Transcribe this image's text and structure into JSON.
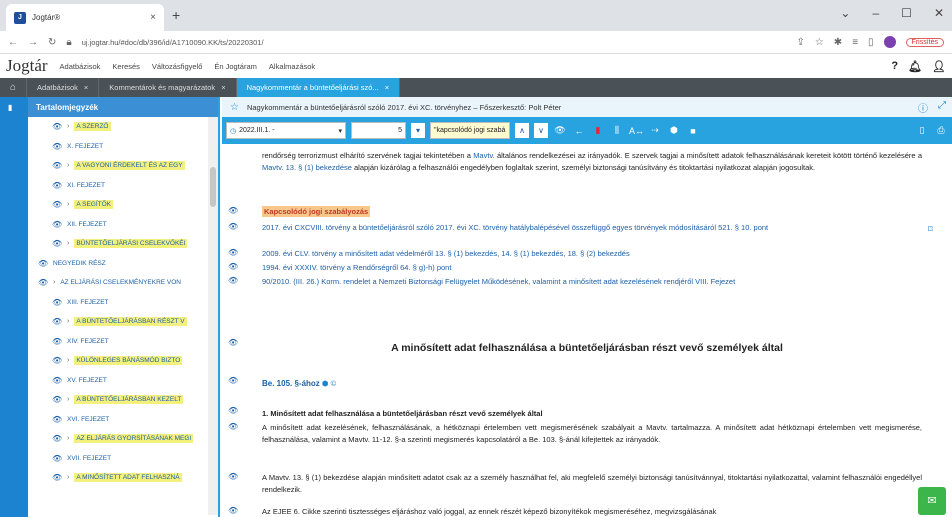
{
  "browser": {
    "tab_title": "Jogtár®",
    "url": "uj.jogtar.hu/#doc/db/396/id/A1710090.KK/ts/20220301/",
    "update_label": "Frissítés",
    "new_tab": "+"
  },
  "app": {
    "logo": "Jogtár",
    "nav": [
      "Adatbázisok",
      "Keresés",
      "Változásfigyelő",
      "Én Jogtáram",
      "Alkalmazások"
    ],
    "doc_tabs": [
      {
        "label": "Adatbázisok",
        "active": false
      },
      {
        "label": "Kommentárok és magyarázatok",
        "active": false
      },
      {
        "label": "Nagykommentár a büntetőeljárási szó...",
        "active": true
      }
    ]
  },
  "toc": {
    "title": "Tartalomjegyzék",
    "items": [
      {
        "label": "A SZERZŐ",
        "hl": true,
        "arrow": true,
        "indent": 2
      },
      {
        "label": "X. FEJEZET",
        "hl": false,
        "arrow": false,
        "indent": 2
      },
      {
        "label": "A VAGYONI ÉRDEKELT ÉS AZ EGY",
        "hl": true,
        "arrow": true,
        "indent": 2
      },
      {
        "label": "XI. FEJEZET",
        "hl": false,
        "arrow": false,
        "indent": 2
      },
      {
        "label": "A SEGÍTŐK",
        "hl": true,
        "arrow": true,
        "indent": 2
      },
      {
        "label": "XII. FEJEZET",
        "hl": false,
        "arrow": false,
        "indent": 2
      },
      {
        "label": "BÜNTETŐELJÁRÁSI CSELEKVŐKÉI",
        "hl": true,
        "arrow": true,
        "indent": 2
      },
      {
        "label": "NEGYEDIK RÉSZ",
        "hl": false,
        "arrow": false,
        "indent": 0
      },
      {
        "label": "AZ ELJÁRÁSI CSELEKMÉNYEKRE VON",
        "hl": false,
        "arrow": true,
        "indent": 0
      },
      {
        "label": "XIII. FEJEZET",
        "hl": false,
        "arrow": false,
        "indent": 2
      },
      {
        "label": "A BÜNTETŐELJÁRÁSBAN RÉSZT V",
        "hl": true,
        "arrow": true,
        "indent": 2
      },
      {
        "label": "XIV. FEJEZET",
        "hl": false,
        "arrow": false,
        "indent": 2
      },
      {
        "label": "KÜLÖNLEGES BÁNÁSMÓD BIZTO",
        "hl": true,
        "arrow": true,
        "indent": 2
      },
      {
        "label": "XV. FEJEZET",
        "hl": false,
        "arrow": false,
        "indent": 2
      },
      {
        "label": "A BÜNTETŐELJÁRÁSBAN KEZELT",
        "hl": true,
        "arrow": true,
        "indent": 2
      },
      {
        "label": "XVI. FEJEZET",
        "hl": false,
        "arrow": false,
        "indent": 2
      },
      {
        "label": "AZ ELJÁRÁS GYORSÍTÁSÁNAK MEGI",
        "hl": true,
        "arrow": true,
        "indent": 2
      },
      {
        "label": "XVII. FEJEZET",
        "hl": false,
        "arrow": false,
        "indent": 2
      },
      {
        "label": "A MINŐSÍTETT ADAT FELHASZNÁ",
        "hl": true,
        "arrow": true,
        "indent": 2
      }
    ]
  },
  "doc": {
    "breadcrumb": "Nagykommentár a büntetőeljárásról szóló 2017. évi XC. törvényhez – Főszerkesztő: Polt Péter",
    "date_select": "2022.III.1. -",
    "page_num": "5",
    "search_value": "\"kapcsolódó jogi szabá",
    "para1_pre": "rendőrség terrorizmust elhárító szervének tagjai tekintetében a ",
    "para1_link1": "Mavtv.",
    "para1_mid": " általános rendelkezései az irányadók. E szervek tagjai a minősített adatok felhasználásának kereteit kötött történő kezelésére a ",
    "para1_link2": "Mavtv. 13. § (1) bekezdése",
    "para1_post": " alapján kizárólag a felhasználói engedélyben foglaltak szerint, személyi biztonsági tanúsítvány és titoktartási nyilatkozat alapján jogosultak.",
    "related_title": "Kapcsolódó jogi szabályozás",
    "rel1": "2017. évi CXCVIII. törvény a büntetőeljárásról szóló 2017. évi XC. törvény hatálybalépésével összefüggő egyes törvények módosításáról 521. § 10. pont",
    "rel2": "2009. évi CLV. törvény a minősített adat védelméről 13. § (1) bekezdés, 14. § (1) bekezdés, 18. § (2) bekezdés",
    "rel3": "1994. évi XXXIV. törvény a Rendőrségről 64. § g)-h) pont",
    "rel4": "90/2010. (III. 26.) Korm. rendelet a Nemzeti Biztonsági Felügyelet Működésének, valamint a minősített adat kezelésének rendjéről VIII. Fejezet",
    "heading": "A minősített adat felhasználása a büntetőeljárásban részt vevő személyek által",
    "section_label": "Be. 105. §-ához",
    "sub_heading": "1. Minősített adat felhasználása a büntetőeljárásban részt vevő személyek által",
    "p2": "A minősített adat kezelésének, felhasználásának, a hétköznapi értelemben vett megismerésének szabályait a Mavtv. tartalmazza. A minősített adat hétköznapi értelemben vett megismerése, felhasználása, valamint a Mavtv. 11-12. §-a szerinti megismerés kapcsolatáról a Be. 103. §-ánál kifejtettek az irányadók.",
    "p3": "A Mavtv. 13. § (1) bekezdése alapján minősített adatot csak az a személy használhat fel, aki megfelelő személyi biztonsági tanúsítvánnyal, titoktartási nyilatkozattal, valamint felhasználói engedéllyel rendelkezik.",
    "p4": "Az EJEE 6. Cikke szerinti tisztességes eljáráshoz való joggal, az ennek részét képező bizonyítékok megismeréséhez, megvizsgálásának"
  }
}
